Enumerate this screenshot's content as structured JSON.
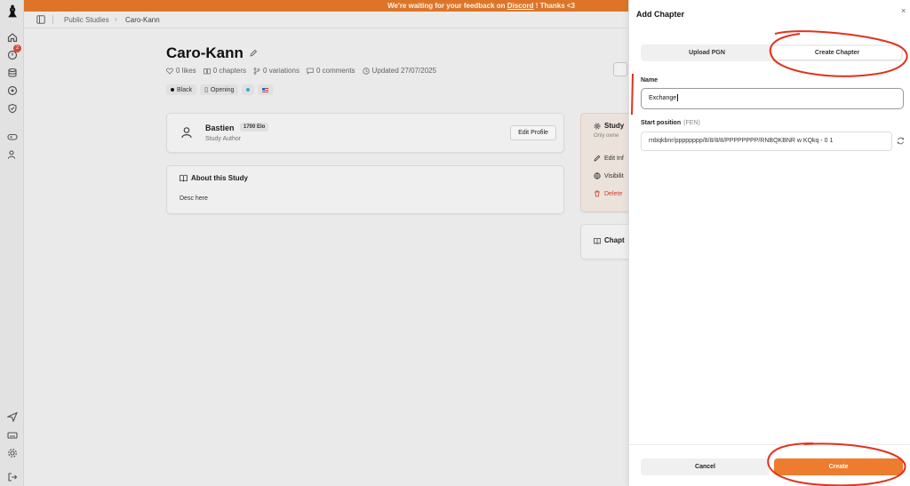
{
  "banner": {
    "corner_text": "",
    "text_before": "We're waiting for your feedback on ",
    "link": "Discord",
    "text_after": " ! Thanks <3"
  },
  "breadcrumb": {
    "items": [
      "Public Studies",
      "Caro-Kann"
    ]
  },
  "study": {
    "title": "Caro-Kann",
    "stats": {
      "likes": "0 likes",
      "chapters": "0 chapters",
      "variations": "0 variations",
      "comments": "0 comments",
      "updated": "Updated 27/07/2025"
    },
    "tags": [
      "Black",
      "Opening"
    ]
  },
  "author": {
    "name": "Bastien",
    "elo": "1700 Elo",
    "role": "Study Author",
    "edit_label": "Edit Profile"
  },
  "about": {
    "title": "About this Study",
    "body": "Desc here"
  },
  "study_panel": {
    "title": "Study",
    "subtitle": "Only owne",
    "items": [
      "Edit Inf",
      "Visibilit",
      "Delete"
    ]
  },
  "chapters_panel": {
    "title": "Chapt"
  },
  "drawer": {
    "title": "Add Chapter",
    "close": "×",
    "tabs": [
      "Upload PGN",
      "Create Chapter"
    ],
    "name_label": "Name",
    "name_value": "Exchange",
    "fen_label": "Start position",
    "fen_hint": "(FEN)",
    "fen_value": "rnbqkbnr/pppppppp/8/8/8/8/PPPPPPPP/RNBQKBNR w KQkq - 0 1",
    "cancel": "Cancel",
    "create": "Create"
  },
  "sidebar": {
    "badge": "2"
  },
  "colors": {
    "accent": "#ee7c2e",
    "banner": "#e77a2a",
    "annotation": "#e0321e",
    "danger": "#d8422c"
  }
}
